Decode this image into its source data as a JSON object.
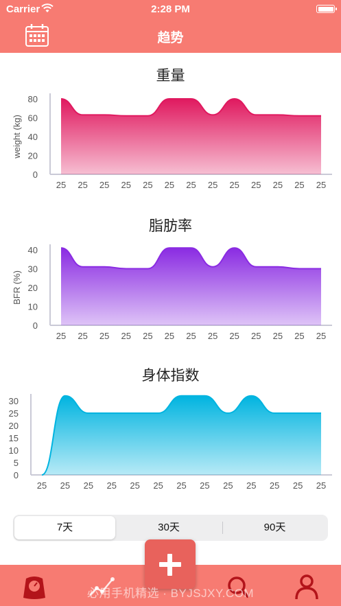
{
  "status_bar": {
    "carrier": "Carrier",
    "time": "2:28 PM"
  },
  "nav": {
    "title": "趋势",
    "calendar_icon": "calendar-icon"
  },
  "colors": {
    "header_bg": "#f77b72",
    "weight_line": "#e0195f",
    "bfr_line": "#8a2be2",
    "bmi_line": "#00b4e0",
    "add_button": "#e8625c"
  },
  "chart_data": [
    {
      "type": "area",
      "title": "重量",
      "xlabel": "",
      "ylabel": "weight (kg)",
      "categories": [
        "25",
        "25",
        "25",
        "25",
        "25",
        "25",
        "25",
        "25",
        "25",
        "25",
        "25",
        "25",
        "25"
      ],
      "values": [
        80,
        63,
        63,
        62,
        62,
        80,
        80,
        63,
        80,
        63,
        63,
        62,
        62
      ],
      "ylim": [
        0,
        80
      ],
      "yticks": [
        0,
        20,
        40,
        60,
        80
      ],
      "grid": false,
      "color": "#e0195f"
    },
    {
      "type": "area",
      "title": "脂肪率",
      "xlabel": "",
      "ylabel": "BFR (%)",
      "categories": [
        "25",
        "25",
        "25",
        "25",
        "25",
        "25",
        "25",
        "25",
        "25",
        "25",
        "25",
        "25",
        "25"
      ],
      "values": [
        41,
        31,
        31,
        30,
        30,
        41,
        41,
        31,
        41,
        31,
        31,
        30,
        30
      ],
      "ylim": [
        0,
        40
      ],
      "yticks": [
        0,
        10,
        20,
        30,
        40
      ],
      "grid": false,
      "color": "#8a2be2"
    },
    {
      "type": "area",
      "title": "身体指数",
      "xlabel": "",
      "ylabel": "",
      "categories": [
        "25",
        "25",
        "25",
        "25",
        "25",
        "25",
        "25",
        "25",
        "25",
        "25",
        "25",
        "25",
        "25"
      ],
      "values": [
        0,
        32,
        25,
        25,
        25,
        25,
        32,
        32,
        25,
        32,
        25,
        25,
        25
      ],
      "ylim": [
        0,
        30
      ],
      "yticks": [
        0,
        5,
        10,
        15,
        20,
        25,
        30
      ],
      "grid": false,
      "color": "#00b4e0"
    }
  ],
  "segment": {
    "options": [
      "7天",
      "30天",
      "90天"
    ],
    "selected": "7天"
  },
  "tabbar": {
    "items": [
      "scale-icon",
      "trend-icon",
      "search-icon",
      "profile-icon"
    ],
    "add_icon": "plus-icon"
  },
  "watermark": "必用手机精选 · BYJSJXY.COM"
}
